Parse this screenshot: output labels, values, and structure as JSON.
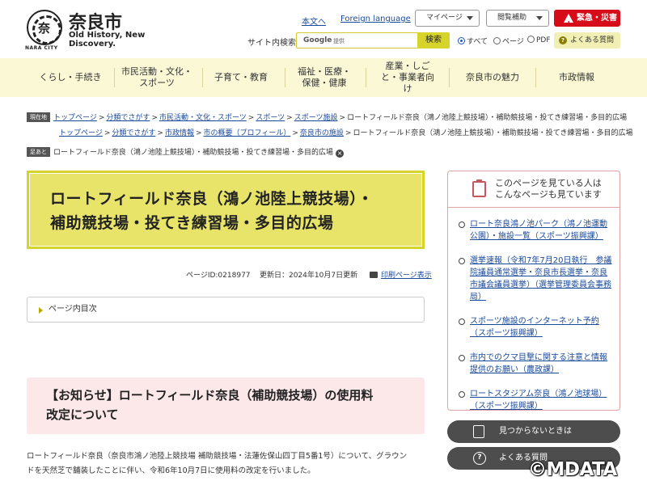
{
  "header": {
    "logo_city_name": "奈良市",
    "logo_caption": "NARA CITY",
    "logo_emblem_text": "奈",
    "tagline": "Old History, New Discovery.",
    "links": {
      "plain_text": "本文へ",
      "foreign_language": "Foreign language"
    },
    "my_page": "マイページ",
    "accessibility": "閲覧補助",
    "emergency": "緊急・災害",
    "search": {
      "label": "サイト内検索",
      "provider": "Google",
      "provided_by": "提供",
      "button": "検索",
      "scope_options": [
        "すべて",
        "ページ",
        "PDF"
      ],
      "selected_scope": "すべて"
    },
    "faq": "よくある質問"
  },
  "nav": {
    "items": [
      {
        "label": "くらし・手続き"
      },
      {
        "label": "市民活動・文化・スポーツ"
      },
      {
        "label": "子育て・教育"
      },
      {
        "label": "福祉・医療・保健・健康"
      },
      {
        "label": "産業・しごと・事業者向け"
      },
      {
        "label": "奈良市の魅力"
      },
      {
        "label": "市政情報"
      }
    ]
  },
  "breadcrumbs": {
    "current_label": "現在地",
    "footprint_label": "足あと",
    "trail1": [
      "トップページ",
      "分類でさがす",
      "市民活動・文化・スポーツ",
      "スポーツ",
      "スポーツ施設"
    ],
    "trail2": [
      "トップページ",
      "分類でさがす",
      "市政情報",
      "市の概要（プロフィール）",
      "奈良市の施設"
    ],
    "current_page": "ロートフィールド奈良（鴻ノ池陸上競技場）・補助競技場・投てき練習場・多目的広場",
    "footprint_page": "ロートフィールド奈良（鴻ノ池陸上競技場）・補助競技場・投てき練習場・多目的広場"
  },
  "page": {
    "title_line1": "ロートフィールド奈良（鴻ノ池陸上競技場）・",
    "title_line2": "補助競技場・投てき練習場・多目的広場",
    "page_id": "ページID:0218977",
    "updated": "更新日：2024年10月7日更新",
    "print": "印刷ページ表示",
    "toc": "ページ内目次",
    "notice_line1": "【お知らせ】ロートフィールド奈良（補助競技場）の使用料",
    "notice_line2": "改定について",
    "body_line1": "ロートフィールド奈良（奈良市鴻ノ池陸上競技場 補助競技場・法蓮佐保山四丁目5番1号）について、グラウン",
    "body_line2": "ドを天然芝で舗装したことに伴い、令和6年10月7日に使用料の改定を行いました。"
  },
  "sidebar": {
    "related_title_line1": "このページを見ている人は",
    "related_title_line2": "こんなページも見ています",
    "related": [
      "ロート奈良鴻ノ池パーク（鴻ノ池運動公園）・施設一覧（スポーツ振興課）",
      "選挙速報（令和7年7月20日執行　参議院議員通常選挙・奈良市長選挙・奈良市議会議員選挙）（選挙管理委員会事務局）",
      "スポーツ施設のインターネット予約（スポーツ振興課）",
      "市内でのクマ目撃に関する注意と情報提供のお願い（農政課）",
      "ロートスタジアム奈良（鴻ノ池球場）（スポーツ振興課）"
    ],
    "not_found": "見つからないときは",
    "faq": "よくある質問"
  },
  "watermark": "©MDATA"
}
